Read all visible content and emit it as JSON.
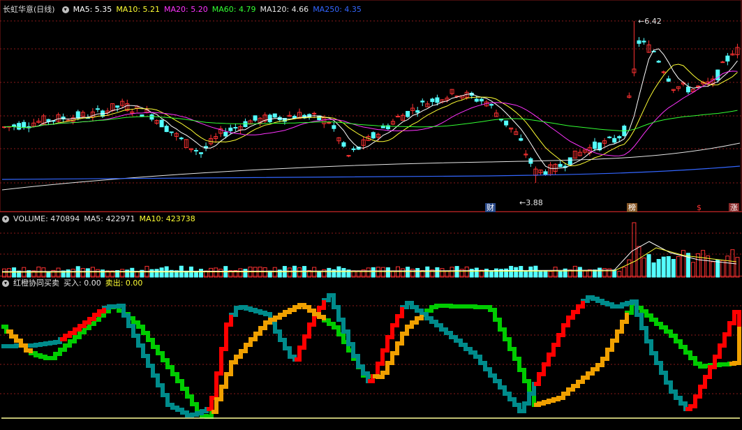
{
  "stock": {
    "title": "长虹华意(日线)",
    "ma": [
      {
        "label": "MA5: 5.35",
        "color": "#ffffff"
      },
      {
        "label": "MA10: 5.21",
        "color": "#ffff33"
      },
      {
        "label": "MA20: 5.20",
        "color": "#ff33ff"
      },
      {
        "label": "MA60: 4.79",
        "color": "#33ff33"
      },
      {
        "label": "MA120: 4.66",
        "color": "#e6e6e6"
      },
      {
        "label": "MA250: 4.35",
        "color": "#3366ff"
      }
    ],
    "high_label": "6.42",
    "low_label": "3.88",
    "event_tags": [
      "财",
      "榜",
      "$",
      "涨"
    ]
  },
  "volume": {
    "label": "VOLUME: 470894",
    "ma5": "MA5: 422971",
    "ma10": "MA10: 423738"
  },
  "indicator": {
    "name": "红橙协同买卖",
    "buy": "买入: 0.00",
    "sell": "卖出: 0.00"
  },
  "colors": {
    "up": "#ff3232",
    "down": "#54ffff",
    "grid": "#8b1a1a",
    "green": "#00cc00",
    "teal": "#008b8b",
    "orange": "#f0a000",
    "red": "#ff0000"
  },
  "chart_data": [
    {
      "type": "candlestick",
      "title": "长虹华意(日线)",
      "y_range": [
        3.6,
        6.6
      ],
      "marked_high": 6.42,
      "marked_low": 3.88,
      "moving_averages": [
        "MA5",
        "MA10",
        "MA20",
        "MA60",
        "MA120",
        "MA250"
      ],
      "ma_last_values": {
        "MA5": 5.35,
        "MA10": 5.21,
        "MA20": 5.2,
        "MA60": 4.79,
        "MA120": 4.66,
        "MA250": 4.35
      }
    },
    {
      "type": "bar",
      "title": "VOLUME",
      "last_value": 470894,
      "ma5": 422971,
      "ma10": 423738
    },
    {
      "type": "line",
      "title": "红橙协同买卖",
      "buy": 0.0,
      "sell": 0.0
    }
  ]
}
